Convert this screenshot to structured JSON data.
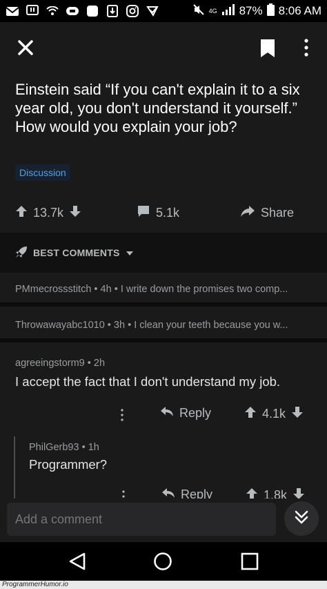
{
  "status_bar": {
    "battery": "87%",
    "time": "8:06 AM",
    "network": "4G",
    "left_icons": [
      "gmail-icon",
      "message-icon",
      "wifi-icon",
      "camera-icon",
      "square-app-icon",
      "download-icon",
      "instagram-icon",
      "check-app-icon"
    ]
  },
  "post": {
    "title": "Einstein said “If you can't explain it to a six year old, you don't understand it yourself.” How would you explain your job?",
    "flair": "Discussion",
    "votes": "13.7k",
    "comments": "5.1k",
    "share_label": "Share"
  },
  "sort": {
    "label": "BEST COMMENTS"
  },
  "collapsed_comments": [
    {
      "author": "PMmecrossstitch",
      "age": "4h",
      "preview": "I write down the promises two comp..."
    },
    {
      "author": "Throwawayabc1010",
      "age": "3h",
      "preview": "I clean your teeth because you w..."
    }
  ],
  "comment": {
    "author": "agreeingstorm9",
    "age": "2h",
    "body": "I accept the fact that I don't understand my job.",
    "reply_label": "Reply",
    "votes": "4.1k"
  },
  "child_comment": {
    "author": "PhilGerb93",
    "age": "1h",
    "body": "Programmer?",
    "reply_label": "Reply",
    "votes": "1.8k"
  },
  "composer": {
    "placeholder": "Add a comment"
  },
  "watermark": "ProgrammerHumor.io",
  "colors": {
    "background": "#1a1a1b",
    "flair_text": "#4da3e6",
    "text": "#d7dadc"
  }
}
